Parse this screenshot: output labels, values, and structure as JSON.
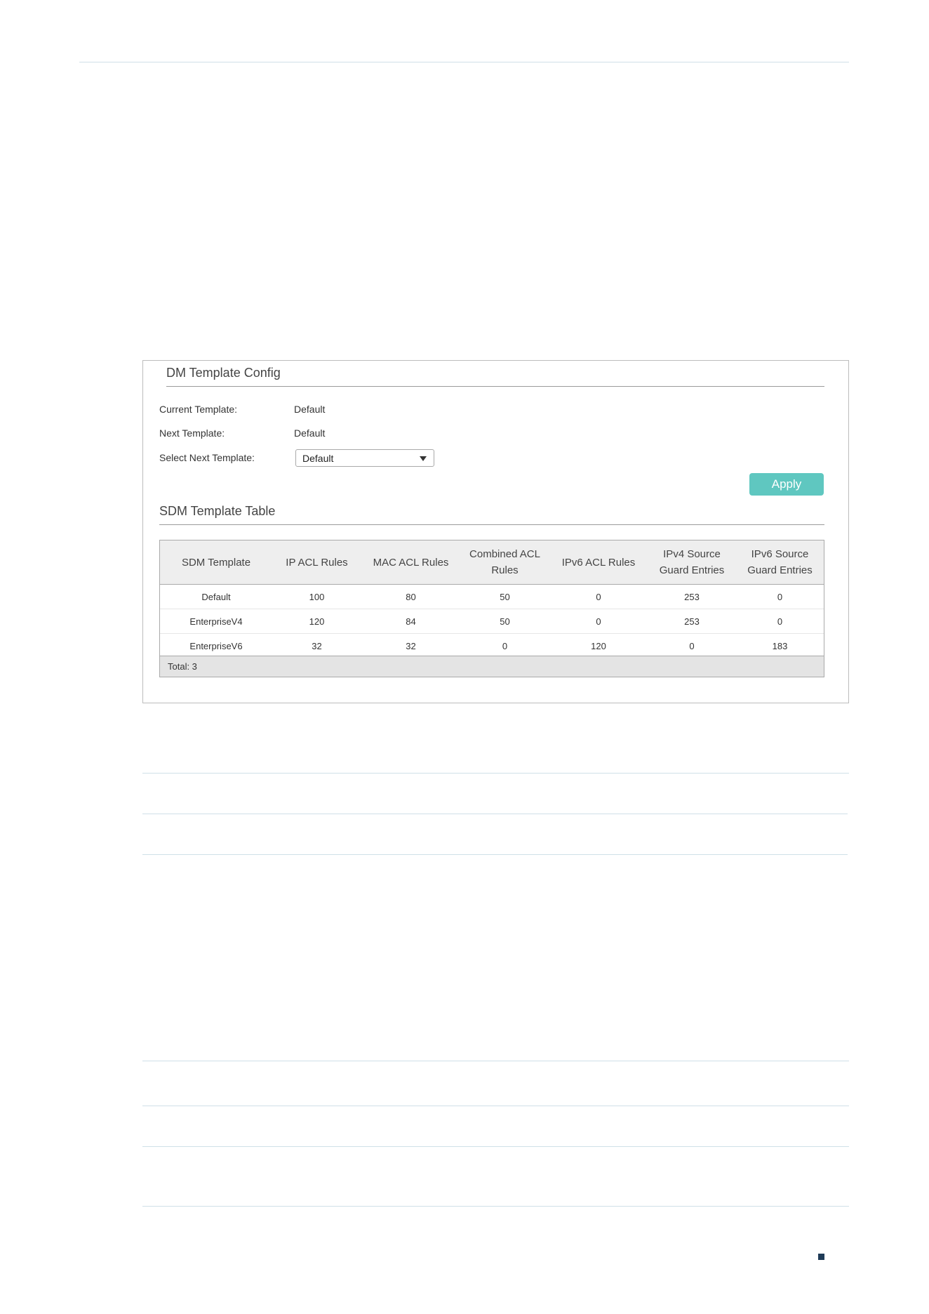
{
  "sdm_config": {
    "title": "DM Template Config",
    "current_template_label": "Current Template:",
    "current_template_value": "Default",
    "next_template_label": "Next Template:",
    "next_template_value": "Default",
    "select_next_label": "Select Next Template:",
    "select_next_value": "Default",
    "apply_label": "Apply"
  },
  "sdm_table": {
    "title": "SDM Template Table",
    "headers": [
      "SDM Template",
      "IP ACL Rules",
      "MAC ACL Rules",
      "Combined ACL Rules",
      "IPv6 ACL Rules",
      "IPv4 Source Guard Entries",
      "IPv6 Source Guard Entries"
    ],
    "rows": [
      [
        "Default",
        "100",
        "80",
        "50",
        "0",
        "253",
        "0"
      ],
      [
        "EnterpriseV4",
        "120",
        "84",
        "50",
        "0",
        "253",
        "0"
      ],
      [
        "EnterpriseV6",
        "32",
        "32",
        "0",
        "120",
        "0",
        "183"
      ]
    ],
    "total": "Total: 3"
  },
  "colors": {
    "apply_button": "#5fc7c0",
    "header_bg": "#eeeeee",
    "footer_bg": "#e4e4e4",
    "page_marker": "#1f3b57"
  }
}
